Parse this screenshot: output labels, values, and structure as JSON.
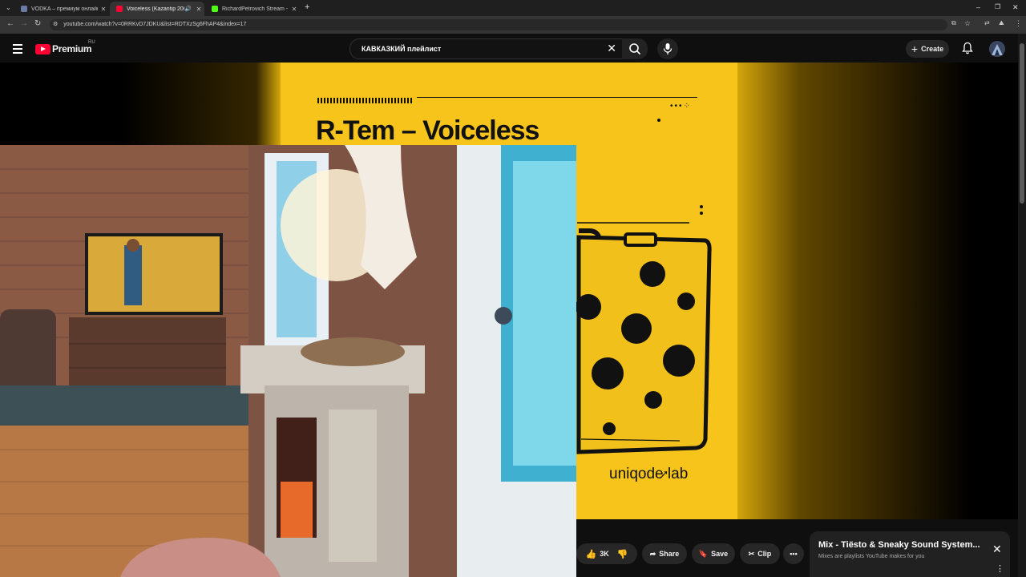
{
  "browser": {
    "tabs": [
      {
        "title": "VODKA – премиум онлайн-ка",
        "favicon_color": "#6a7ba8",
        "active": false
      },
      {
        "title": "Voiceless (Kazantip 2005 M",
        "favicon_color": "#ff0033",
        "active": true
      },
      {
        "title": "RichardPetrovich Stream - Wat",
        "favicon_color": "#53fc18",
        "active": false
      }
    ],
    "new_tab_label": "+",
    "url": "youtube.com/watch?v=0RRKvD7JDKU&list=RDTXzSg6FhAP4&index=17"
  },
  "youtube": {
    "brand": "Premium",
    "region": "RU",
    "search_query": "КАВКАЗКИЙ плейлист",
    "create_label": "Create"
  },
  "video": {
    "cover_title": "R-Tem – Voiceless",
    "cover_label": "uniqode lab",
    "cover_color": "#f7c41b"
  },
  "actions": {
    "like_count": "3K",
    "share_label": "Share",
    "save_label": "Save",
    "clip_label": "Clip"
  },
  "mix_panel": {
    "title": "Mix - Tiësto & Sneaky Sound System...",
    "subtitle": "Mixes are playlists YouTube makes for you"
  }
}
